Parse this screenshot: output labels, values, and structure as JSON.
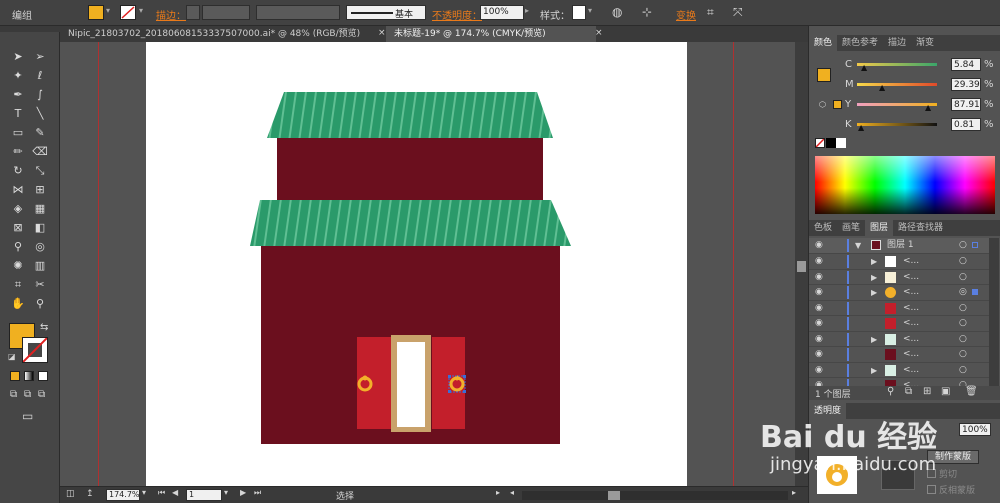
{
  "control_bar": {
    "selection_label": "编组",
    "stroke_label": "描边：",
    "stroke_style": "基本",
    "opacity_label": "不透明度：",
    "opacity_value": "100%",
    "style_label": "样式：",
    "transform_label": "变换"
  },
  "doc_tabs": [
    {
      "label": "Nipic_21803702_20180608153337507000.ai* @ 48% (RGB/预览)",
      "active": false
    },
    {
      "label": "未标题-19* @ 174.7% (CMYK/预览)",
      "active": true
    }
  ],
  "status_bar": {
    "zoom": "174.7%",
    "page": "1",
    "tool_status": "选择"
  },
  "color_panel": {
    "tabs": [
      "颜色",
      "颜色参考",
      "描边",
      "渐变"
    ],
    "active_tab": "颜色",
    "channels": [
      {
        "label": "C",
        "value": "5.84",
        "unit": "%",
        "fill": 0.06
      },
      {
        "label": "M",
        "value": "29.39",
        "unit": "%",
        "fill": 0.29
      },
      {
        "label": "Y",
        "value": "87.91",
        "unit": "%",
        "fill": 0.88
      },
      {
        "label": "K",
        "value": "0.81",
        "unit": "%",
        "fill": 0.01
      }
    ],
    "fill_color": "#f0b020"
  },
  "layers_panel": {
    "tabs": [
      "色板",
      "画笔",
      "图层",
      "路径查找器"
    ],
    "active_tab": "图层",
    "layer_name": "图层 1",
    "sublayers": [
      "<...",
      "<...",
      "<...",
      "<...",
      "<...",
      "<...",
      "<...",
      "<...",
      "<..."
    ],
    "footer": "1 个图层"
  },
  "transparency_panel": {
    "title": "透明度",
    "opacity": "100%",
    "make_mask": "制作蒙版",
    "clip_label": "剪切",
    "invert_label": "反相蒙版"
  },
  "watermark": {
    "brand": "Bai du 经验",
    "url": "jingyan.baidu.com"
  },
  "colors": {
    "roof_green": "#2a9a6a",
    "wall_red": "#6b0f1e",
    "door_red": "#c31f2b",
    "door_frame": "#c9a26b",
    "knocker_gold": "#f2b02a",
    "accent_orange": "#ea7a1a"
  }
}
